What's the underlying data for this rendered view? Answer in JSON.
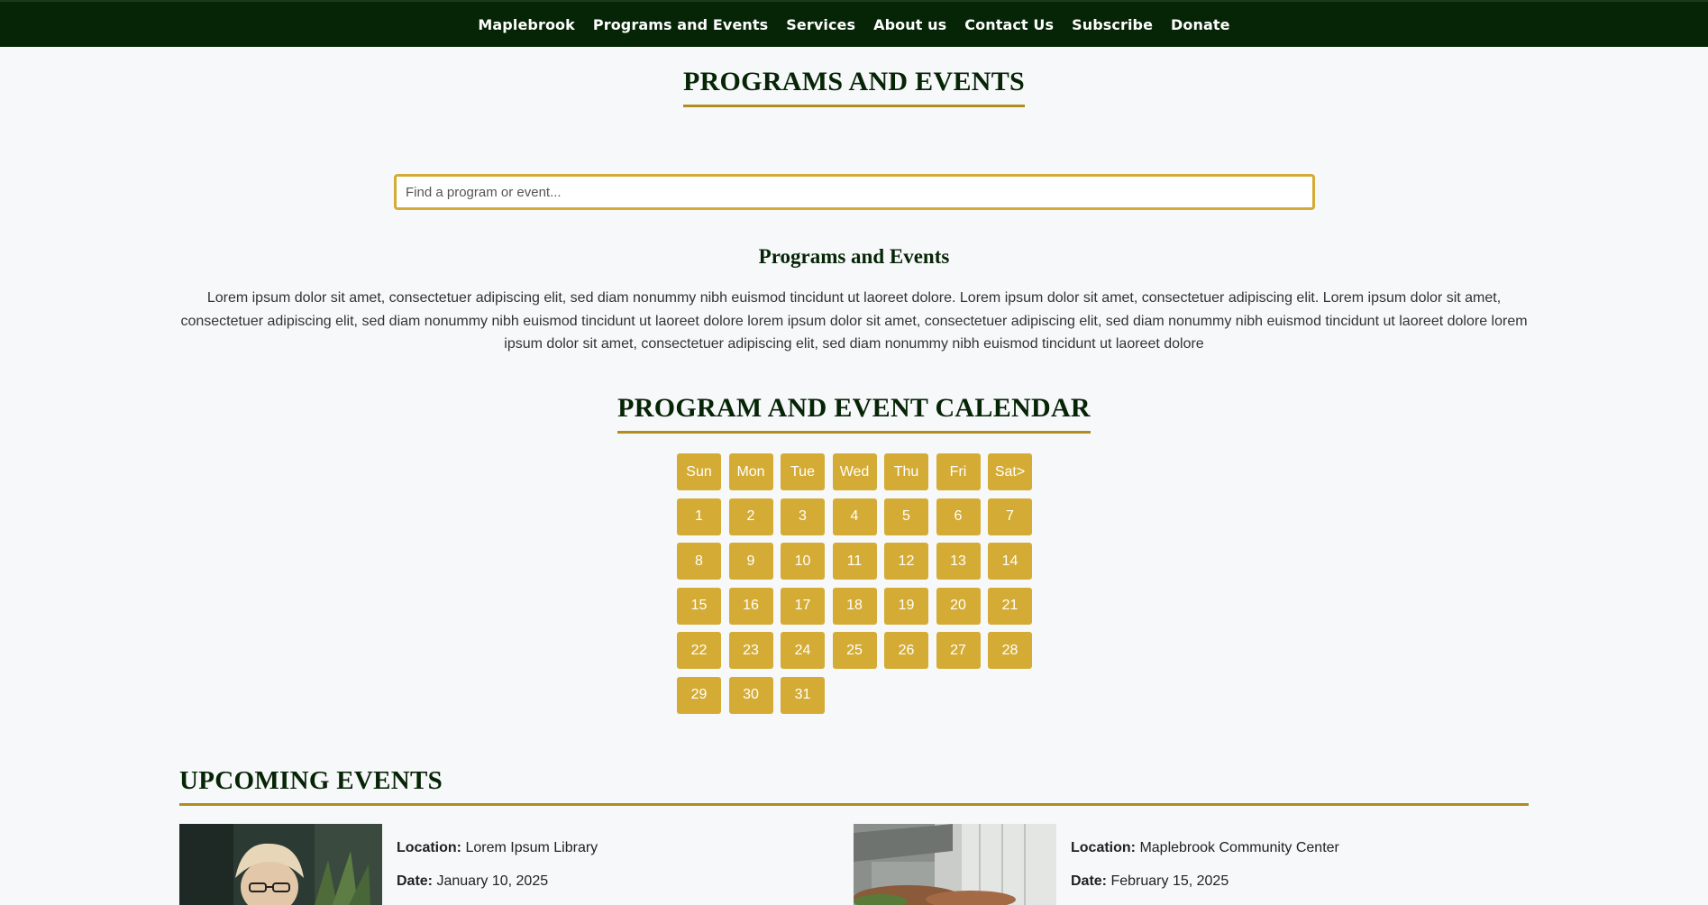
{
  "nav": {
    "items": [
      {
        "label": "Maplebrook"
      },
      {
        "label": "Programs and Events"
      },
      {
        "label": "Services"
      },
      {
        "label": "About us"
      },
      {
        "label": "Contact Us"
      },
      {
        "label": "Subscribe"
      },
      {
        "label": "Donate"
      }
    ]
  },
  "page": {
    "title": "PROGRAMS AND EVENTS"
  },
  "search": {
    "placeholder": "Find a program or event...",
    "value": ""
  },
  "intro": {
    "title": "Programs and Events",
    "text": "Lorem ipsum dolor sit amet, consectetuer adipiscing elit, sed diam nonummy nibh euismod tincidunt ut laoreet dolore. Lorem ipsum dolor sit amet, consectetuer adipiscing elit. Lorem ipsum dolor sit amet, consectetuer adipiscing elit, sed diam nonummy nibh euismod tincidunt ut laoreet dolore lorem ipsum dolor sit amet, consectetuer adipiscing elit, sed diam nonummy nibh euismod tincidunt ut laoreet dolore lorem ipsum dolor sit amet, consectetuer adipiscing elit, sed diam nonummy nibh euismod tincidunt ut laoreet dolore"
  },
  "calendar": {
    "title": "PROGRAM AND EVENT CALENDAR",
    "weekdays": [
      "Sun",
      "Mon",
      "Tue",
      "Wed",
      "Thu",
      "Fri",
      "Sat>"
    ],
    "days": [
      "1",
      "2",
      "3",
      "4",
      "5",
      "6",
      "7",
      "8",
      "9",
      "10",
      "11",
      "12",
      "13",
      "14",
      "15",
      "16",
      "17",
      "18",
      "19",
      "20",
      "21",
      "22",
      "23",
      "24",
      "25",
      "26",
      "27",
      "28",
      "29",
      "30",
      "31"
    ]
  },
  "upcoming": {
    "title": "UPCOMING EVENTS",
    "location_label": "Location:",
    "date_label": "Date:",
    "events": [
      {
        "location": "Lorem Ipsum Library",
        "date": "January 10, 2025",
        "image": "woman-with-glasses-photo"
      },
      {
        "location": "Maplebrook Community Center",
        "date": "February 15, 2025",
        "image": "building-exterior-photo"
      }
    ]
  },
  "colors": {
    "nav_bg": "#062506",
    "accent_gold": "#d4ac35",
    "heading_green": "#062506",
    "underline_gold": "#b08d1e"
  }
}
